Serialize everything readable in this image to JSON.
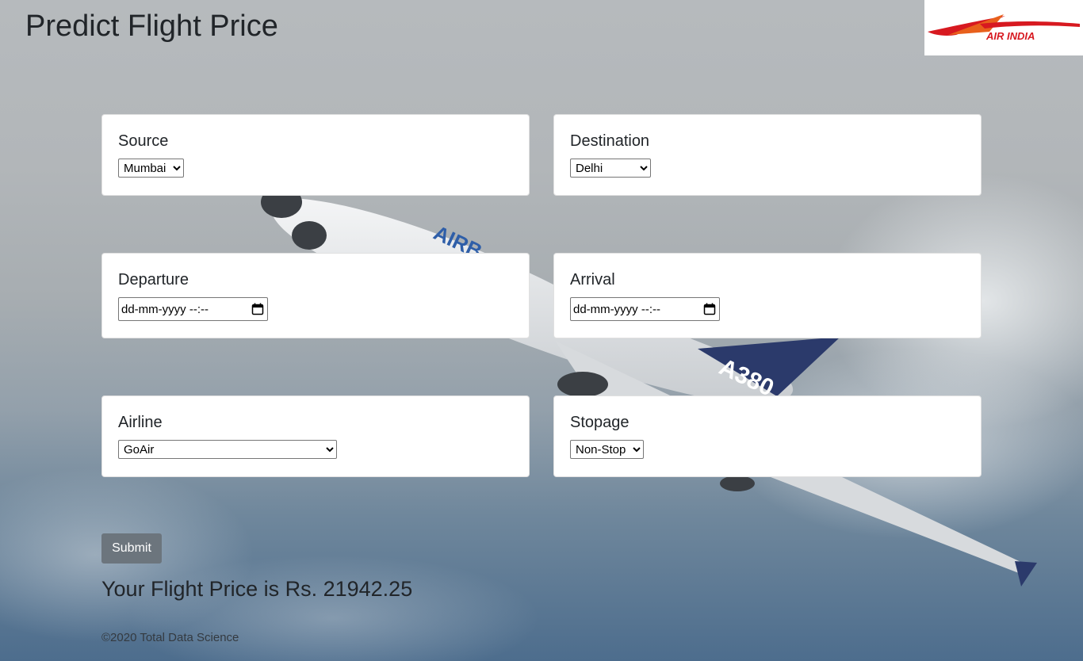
{
  "header": {
    "title": "Predict Flight Price",
    "logo_text": "AIR INDIA"
  },
  "form": {
    "source": {
      "label": "Source",
      "value": "Mumbai"
    },
    "destination": {
      "label": "Destination",
      "value": "Delhi"
    },
    "departure": {
      "label": "Departure",
      "placeholder": "dd-mm-yyyy --:--"
    },
    "arrival": {
      "label": "Arrival",
      "placeholder": "dd-mm-yyyy --:--"
    },
    "airline": {
      "label": "Airline",
      "value": "GoAir"
    },
    "stopage": {
      "label": "Stopage",
      "value": "Non-Stop"
    },
    "submit_label": "Submit"
  },
  "result_text": "Your Flight Price is Rs. 21942.25",
  "footer_text": "©2020 Total Data Science",
  "colors": {
    "button": "#6c757d",
    "logo_red": "#d71920"
  }
}
